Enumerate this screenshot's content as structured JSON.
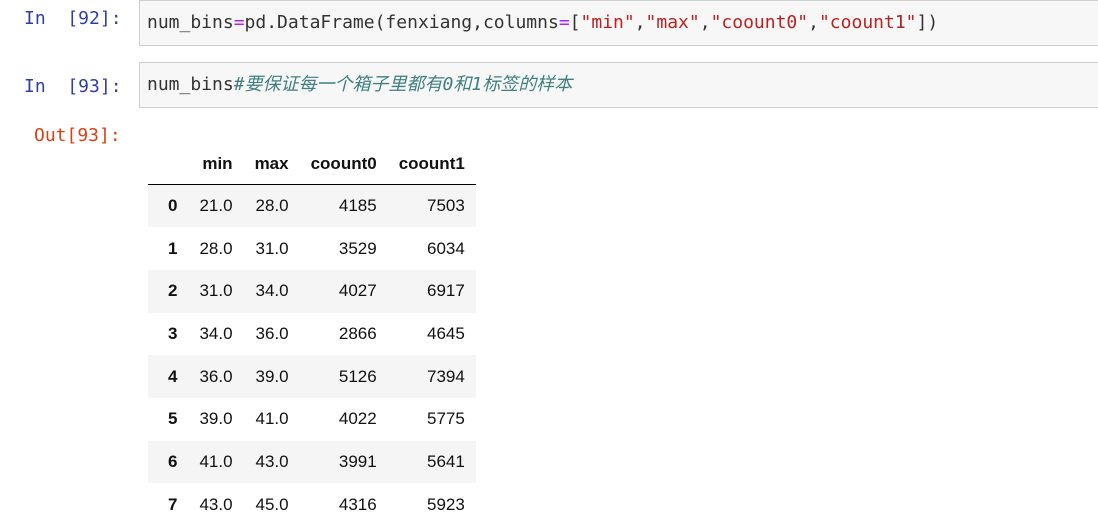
{
  "cells": [
    {
      "prompt": "In  [92]:",
      "code_parts": [
        {
          "text": "num_bins",
          "kind": "default"
        },
        {
          "text": "=",
          "kind": "op"
        },
        {
          "text": "pd.DataFrame(fenxiang,columns",
          "kind": "default"
        },
        {
          "text": "=",
          "kind": "op"
        },
        {
          "text": "[",
          "kind": "default"
        },
        {
          "text": "\"min\"",
          "kind": "str"
        },
        {
          "text": ",",
          "kind": "default"
        },
        {
          "text": "\"max\"",
          "kind": "str"
        },
        {
          "text": ",",
          "kind": "default"
        },
        {
          "text": "\"coount0\"",
          "kind": "str"
        },
        {
          "text": ",",
          "kind": "default"
        },
        {
          "text": "\"coount1\"",
          "kind": "str"
        },
        {
          "text": "])",
          "kind": "default"
        }
      ]
    },
    {
      "prompt": "In  [93]:",
      "code_parts": [
        {
          "text": "num_bins",
          "kind": "default"
        },
        {
          "text": "#要保证每一个箱子里都有0和1标签的样本",
          "kind": "comment"
        }
      ]
    }
  ],
  "output": {
    "prompt": "Out[93]:",
    "table": {
      "index_header": "",
      "columns": [
        "min",
        "max",
        "coount0",
        "coount1"
      ],
      "rows": [
        {
          "index": "0",
          "values": [
            "21.0",
            "28.0",
            "4185",
            "7503"
          ]
        },
        {
          "index": "1",
          "values": [
            "28.0",
            "31.0",
            "3529",
            "6034"
          ]
        },
        {
          "index": "2",
          "values": [
            "31.0",
            "34.0",
            "4027",
            "6917"
          ]
        },
        {
          "index": "3",
          "values": [
            "34.0",
            "36.0",
            "2866",
            "4645"
          ]
        },
        {
          "index": "4",
          "values": [
            "36.0",
            "39.0",
            "5126",
            "7394"
          ]
        },
        {
          "index": "5",
          "values": [
            "39.0",
            "41.0",
            "4022",
            "5775"
          ]
        },
        {
          "index": "6",
          "values": [
            "41.0",
            "43.0",
            "3991",
            "5641"
          ]
        },
        {
          "index": "7",
          "values": [
            "43.0",
            "45.0",
            "4316",
            "5923"
          ]
        }
      ]
    }
  },
  "colors": {
    "prompt_in": "#303f9f",
    "prompt_out": "#d84315",
    "operator": "#aa22ff",
    "string": "#ba2121",
    "comment": "#408080",
    "cell_background": "#f7f7f7",
    "cell_border": "#cfcfcf",
    "row_stripe": "#f5f5f5"
  }
}
